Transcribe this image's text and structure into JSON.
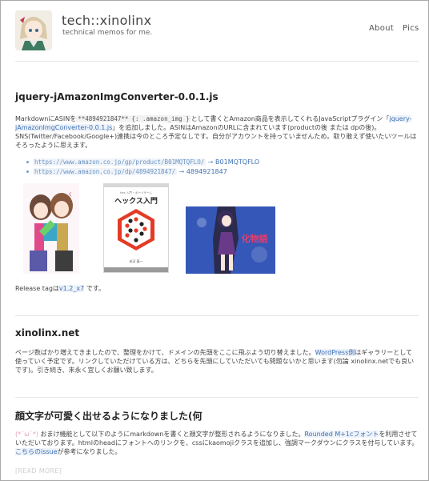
{
  "site": {
    "title": "tech::xinolinx",
    "subtitle": "technical memos for me."
  },
  "nav": {
    "about": "About",
    "pics": "Pics"
  },
  "post1": {
    "title": "jquery-jAmazonImgConverter-0.0.1.js",
    "line1_a": "MarkdownにASINを",
    "line1_code1": "**4894921847**",
    "line1_b": "{: .amazon_img }",
    "line1_c": "として書くとAmazon商品を表示してくれるJavaScriptプラグイン「",
    "line1_link": "jquery-jAmazonImgConverter-0.0.1.js",
    "line1_d": "」を追加しました。ASINはAmazonのURLに含まれています(productの後 または dpの後)。",
    "line2": "SNS(Twitter/Facebook/Google+)連携は今のところ予定なしです。自分がアカウントを持っていませんため。取り敢えず使いたいツールはそろったように思えます。",
    "links": [
      {
        "url": "https://www.amazon.co.jp/gp/product/B01MQTQFLO/",
        "arrow": "→",
        "asin": "B01MQTQFLO"
      },
      {
        "url": "https://www.amazon.co.jp/dp/4894921847/",
        "arrow": "→",
        "asin": "4894921847"
      }
    ],
    "book_title": "ヘックス入門",
    "book_top": "Hex 入門 ─ ボードゲーム",
    "book_author": "米沢 真一",
    "manga_title": "化物語",
    "release_prefix": "Release tagは",
    "release_tag": "v1.2_x7",
    "release_suffix": " です。"
  },
  "post2": {
    "title": "xinolinx.net",
    "body_a": "ページ数ばかり増えてきましたので、整理をかけて、ドメインの先頭をここに飛ぶよう切り替えました。",
    "body_link": "WordPress側",
    "body_b": "はギャラリーとして使っていく予定です。リンクしていただけている方は、どちらを先頭にしていただいても問題ないかと思います(勿論 xinolinx.netでも良いです)。引き続き、末永く宜しくお願い致します。"
  },
  "post3": {
    "title": "顔文字が可愛く出せるようになりました(何",
    "kaomoji": "(*´ω`*)",
    "body_a": "おまけ機能として以下のようにmarkdownを書くと顔文字が整形されるようになりました。",
    "body_link1": "Rounded M+1cフォント",
    "body_b": "を利用させていただいております。htmlのheadにフォントへのリンクを、cssにkaomojiクラスを追加し、強調マークダウンにクラスを付与しています。",
    "body_link2": "こちらのissue",
    "body_c": "が参考になりました。"
  },
  "read_more": "[READ MORE]",
  "colors": {
    "link": "#3d6fb3",
    "divider": "#e6e6e6",
    "border": "#a8a8a8"
  }
}
